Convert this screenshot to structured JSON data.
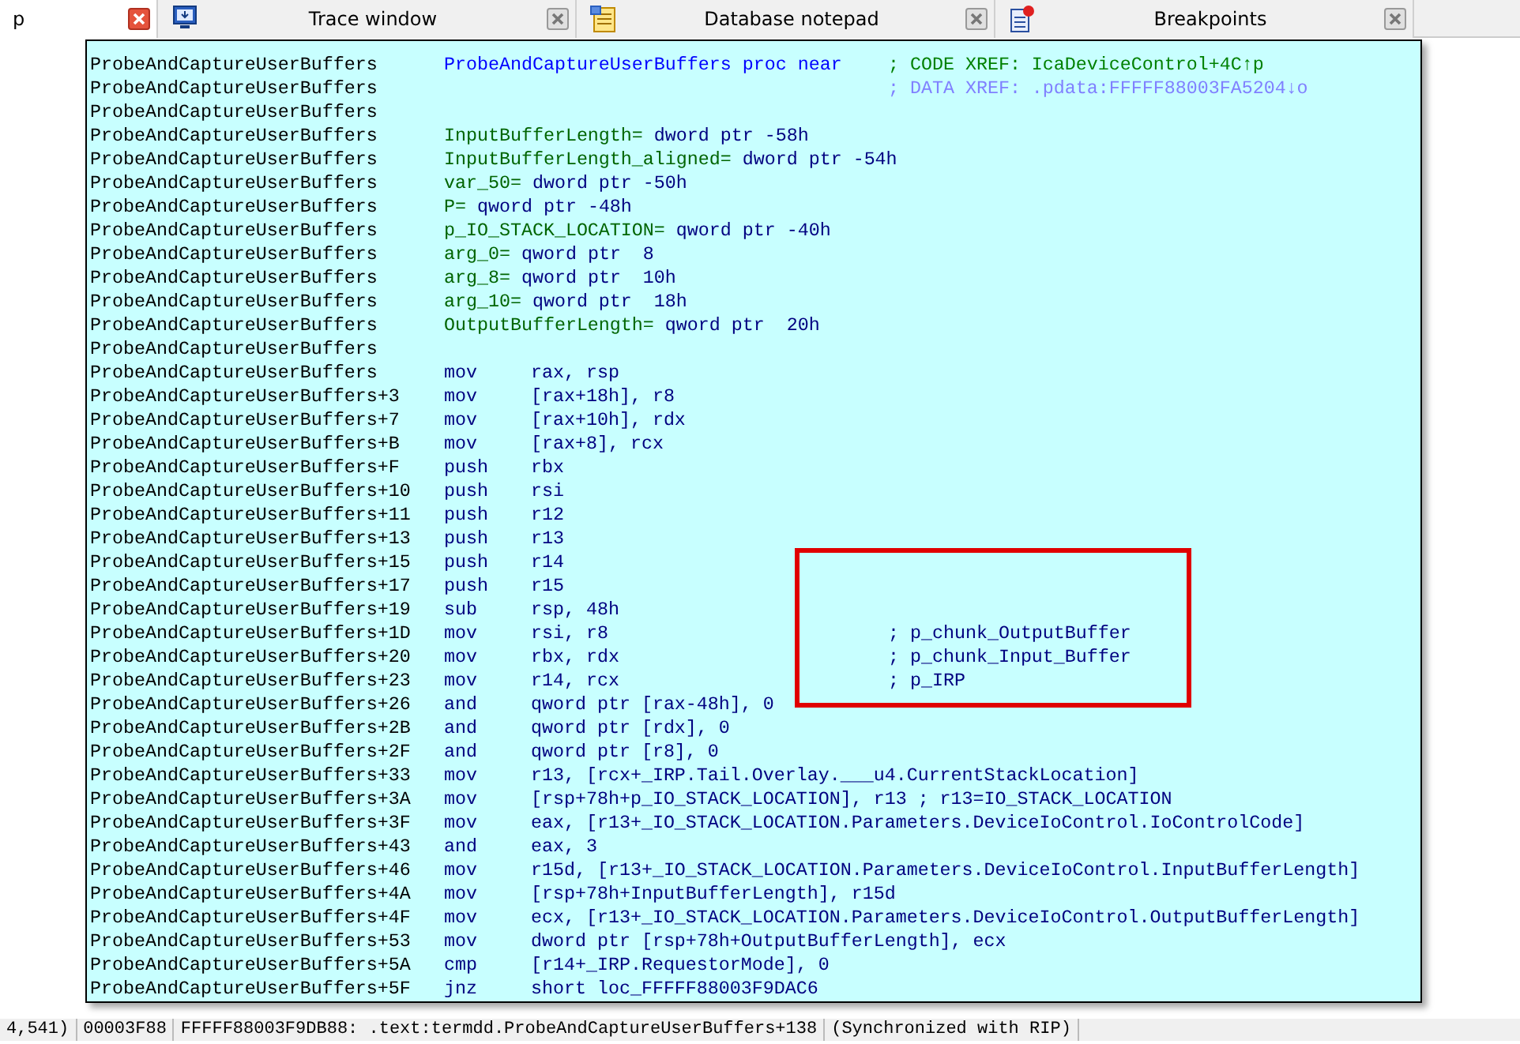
{
  "tabs": [
    {
      "label": "p",
      "kind": "plain",
      "selected": true
    },
    {
      "label": "Trace window",
      "kind": "trace",
      "selected": false
    },
    {
      "label": "Database notepad",
      "kind": "notepad",
      "selected": false
    },
    {
      "label": "Breakpoints",
      "kind": "breakpoints",
      "selected": false
    }
  ],
  "listing": {
    "rows": [
      {
        "addr": "ProbeAndCaptureUserBuffers",
        "kind": "proc",
        "text": "ProbeAndCaptureUserBuffers proc near",
        "comment": {
          "text": "; CODE XREF: IcaDeviceControl+4C↑p",
          "kind": "code_xref"
        }
      },
      {
        "addr": "ProbeAndCaptureUserBuffers",
        "kind": "comment",
        "comment": {
          "text": "; DATA XREF: .pdata:FFFFF88003FA5204↓o",
          "kind": "data_xref"
        }
      },
      {
        "addr": "ProbeAndCaptureUserBuffers",
        "kind": "blank"
      },
      {
        "addr": "ProbeAndCaptureUserBuffers",
        "kind": "var",
        "name": "InputBufferLength=",
        "text": "dword ptr -58h"
      },
      {
        "addr": "ProbeAndCaptureUserBuffers",
        "kind": "var",
        "name": "InputBufferLength_aligned=",
        "text": "dword ptr -54h"
      },
      {
        "addr": "ProbeAndCaptureUserBuffers",
        "kind": "var",
        "name": "var_50=",
        "text": "dword ptr -50h"
      },
      {
        "addr": "ProbeAndCaptureUserBuffers",
        "kind": "var",
        "name": "P=",
        "text": "qword ptr -48h"
      },
      {
        "addr": "ProbeAndCaptureUserBuffers",
        "kind": "var",
        "name": "p_IO_STACK_LOCATION=",
        "text": "qword ptr -40h"
      },
      {
        "addr": "ProbeAndCaptureUserBuffers",
        "kind": "var",
        "name": "arg_0=",
        "text": "qword ptr  8"
      },
      {
        "addr": "ProbeAndCaptureUserBuffers",
        "kind": "var",
        "name": "arg_8=",
        "text": "qword ptr  10h"
      },
      {
        "addr": "ProbeAndCaptureUserBuffers",
        "kind": "var",
        "name": "arg_10=",
        "text": "qword ptr  18h"
      },
      {
        "addr": "ProbeAndCaptureUserBuffers",
        "kind": "var",
        "name": "OutputBufferLength=",
        "text": "qword ptr  20h"
      },
      {
        "addr": "ProbeAndCaptureUserBuffers",
        "kind": "blank"
      },
      {
        "addr": "ProbeAndCaptureUserBuffers",
        "kind": "insn",
        "mnemonic": "mov",
        "operands": "rax, rsp"
      },
      {
        "addr": "ProbeAndCaptureUserBuffers+3",
        "kind": "insn",
        "mnemonic": "mov",
        "operands": "[rax+18h], r8"
      },
      {
        "addr": "ProbeAndCaptureUserBuffers+7",
        "kind": "insn",
        "mnemonic": "mov",
        "operands": "[rax+10h], rdx"
      },
      {
        "addr": "ProbeAndCaptureUserBuffers+B",
        "kind": "insn",
        "mnemonic": "mov",
        "operands": "[rax+8], rcx"
      },
      {
        "addr": "ProbeAndCaptureUserBuffers+F",
        "kind": "insn",
        "mnemonic": "push",
        "operands": "rbx"
      },
      {
        "addr": "ProbeAndCaptureUserBuffers+10",
        "kind": "insn",
        "mnemonic": "push",
        "operands": "rsi"
      },
      {
        "addr": "ProbeAndCaptureUserBuffers+11",
        "kind": "insn",
        "mnemonic": "push",
        "operands": "r12"
      },
      {
        "addr": "ProbeAndCaptureUserBuffers+13",
        "kind": "insn",
        "mnemonic": "push",
        "operands": "r13"
      },
      {
        "addr": "ProbeAndCaptureUserBuffers+15",
        "kind": "insn",
        "mnemonic": "push",
        "operands": "r14"
      },
      {
        "addr": "ProbeAndCaptureUserBuffers+17",
        "kind": "insn",
        "mnemonic": "push",
        "operands": "r15"
      },
      {
        "addr": "ProbeAndCaptureUserBuffers+19",
        "kind": "insn",
        "mnemonic": "sub",
        "operands": "rsp, 48h"
      },
      {
        "addr": "ProbeAndCaptureUserBuffers+1D",
        "kind": "insn",
        "mnemonic": "mov",
        "operands": "rsi, r8",
        "comment": {
          "text": "; p_chunk_OutputBuffer",
          "kind": "note"
        }
      },
      {
        "addr": "ProbeAndCaptureUserBuffers+20",
        "kind": "insn",
        "mnemonic": "mov",
        "operands": "rbx, rdx",
        "comment": {
          "text": "; p_chunk_Input_Buffer",
          "kind": "note"
        }
      },
      {
        "addr": "ProbeAndCaptureUserBuffers+23",
        "kind": "insn",
        "mnemonic": "mov",
        "operands": "r14, rcx",
        "comment": {
          "text": "; p_IRP",
          "kind": "note"
        }
      },
      {
        "addr": "ProbeAndCaptureUserBuffers+26",
        "kind": "insn",
        "mnemonic": "and",
        "operands": "qword ptr [rax-48h], 0"
      },
      {
        "addr": "ProbeAndCaptureUserBuffers+2B",
        "kind": "insn",
        "mnemonic": "and",
        "operands": "qword ptr [rdx], 0"
      },
      {
        "addr": "ProbeAndCaptureUserBuffers+2F",
        "kind": "insn",
        "mnemonic": "and",
        "operands": "qword ptr [r8], 0"
      },
      {
        "addr": "ProbeAndCaptureUserBuffers+33",
        "kind": "insn",
        "mnemonic": "mov",
        "operands": "r13, [rcx+_IRP.Tail.Overlay.___u4.CurrentStackLocation]"
      },
      {
        "addr": "ProbeAndCaptureUserBuffers+3A",
        "kind": "insn",
        "mnemonic": "mov",
        "operands": "[rsp+78h+p_IO_STACK_LOCATION], r13 ; r13=IO_STACK_LOCATION"
      },
      {
        "addr": "ProbeAndCaptureUserBuffers+3F",
        "kind": "insn",
        "mnemonic": "mov",
        "operands": "eax, [r13+_IO_STACK_LOCATION.Parameters.DeviceIoControl.IoControlCode]"
      },
      {
        "addr": "ProbeAndCaptureUserBuffers+43",
        "kind": "insn",
        "mnemonic": "and",
        "operands": "eax, 3"
      },
      {
        "addr": "ProbeAndCaptureUserBuffers+46",
        "kind": "insn",
        "mnemonic": "mov",
        "operands": "r15d, [r13+_IO_STACK_LOCATION.Parameters.DeviceIoControl.InputBufferLength]"
      },
      {
        "addr": "ProbeAndCaptureUserBuffers+4A",
        "kind": "insn",
        "mnemonic": "mov",
        "operands": "[rsp+78h+InputBufferLength], r15d"
      },
      {
        "addr": "ProbeAndCaptureUserBuffers+4F",
        "kind": "insn",
        "mnemonic": "mov",
        "operands": "ecx, [r13+_IO_STACK_LOCATION.Parameters.DeviceIoControl.OutputBufferLength]"
      },
      {
        "addr": "ProbeAndCaptureUserBuffers+53",
        "kind": "insn",
        "mnemonic": "mov",
        "operands": "dword ptr [rsp+78h+OutputBufferLength], ecx"
      },
      {
        "addr": "ProbeAndCaptureUserBuffers+5A",
        "kind": "insn",
        "mnemonic": "cmp",
        "operands": "[r14+_IRP.RequestorMode], 0"
      },
      {
        "addr": "ProbeAndCaptureUserBuffers+5F",
        "kind": "insn",
        "mnemonic": "jnz",
        "operands": "short loc_FFFFF88003F9DAC6"
      }
    ]
  },
  "status_bar": [
    "4,541)",
    "00003F88",
    "FFFFF88003F9DB88: .text:termdd.ProbeAndCaptureUserBuffers+138",
    "(Synchronized with RIP)"
  ]
}
